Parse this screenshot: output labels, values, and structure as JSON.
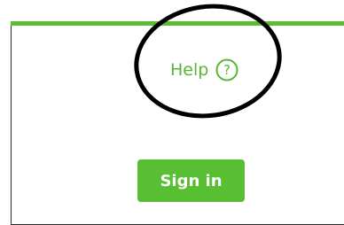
{
  "help": {
    "label": "Help",
    "icon": "question-circle-icon",
    "color": "#58b535"
  },
  "annotation": {
    "shape": "circle"
  },
  "sign_in": {
    "label": "Sign in",
    "color": "#58bf32"
  },
  "accent": {
    "top_border": "#5bbd34"
  }
}
